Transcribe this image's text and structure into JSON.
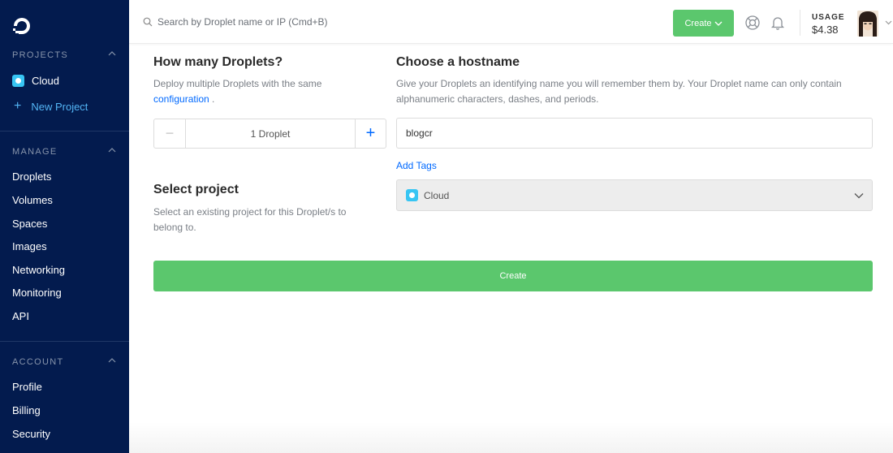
{
  "sidebar": {
    "projects_heading": "PROJECTS",
    "project_name": "Cloud",
    "new_project_label": "New Project",
    "manage_heading": "MANAGE",
    "manage_items": [
      "Droplets",
      "Volumes",
      "Spaces",
      "Images",
      "Networking",
      "Monitoring",
      "API"
    ],
    "account_heading": "ACCOUNT",
    "account_items": [
      "Profile",
      "Billing",
      "Security"
    ]
  },
  "header": {
    "search_placeholder": "Search by Droplet name or IP (Cmd+B)",
    "create_label": "Create",
    "usage_label": "USAGE",
    "usage_value": "$4.38",
    "icons": [
      "search-icon",
      "help-icon",
      "bell-icon",
      "avatar",
      "chevron-down-icon"
    ]
  },
  "droplets": {
    "heading": "How many Droplets?",
    "desc_prefix": "Deploy multiple Droplets with the same",
    "desc_link": "configuration",
    "desc_suffix": " .",
    "count_label": "1  Droplet",
    "minus_label": "−",
    "plus_label": "+"
  },
  "hostname": {
    "heading": "Choose a hostname",
    "description": "Give your Droplets an identifying name you will remember them by. Your Droplet name can only contain alphanumeric characters, dashes, and periods.",
    "value": "blogcr",
    "add_tags_label": "Add Tags"
  },
  "project": {
    "heading": "Select project",
    "description": "Select an existing project for this Droplet/s to belong to.",
    "selected": "Cloud"
  },
  "submit_label": "Create",
  "colors": {
    "sidebar_bg": "#031b4e",
    "accent_green": "#5bc76d",
    "link_blue": "#0069ff",
    "project_dot": "#37c5f3"
  }
}
